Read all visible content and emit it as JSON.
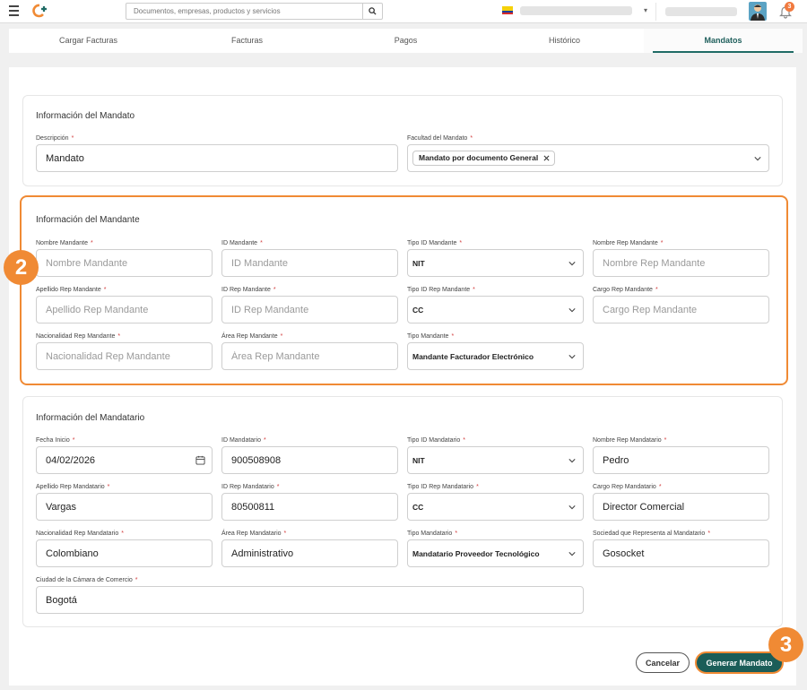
{
  "topbar": {
    "search_placeholder": "Documentos, empresas, productos y servicios",
    "notifications_count": "3",
    "accent": "#f08a34"
  },
  "tabs": [
    {
      "label": "Cargar Facturas"
    },
    {
      "label": "Facturas"
    },
    {
      "label": "Pagos"
    },
    {
      "label": "Histórico"
    },
    {
      "label": "Mandatos",
      "active": true
    }
  ],
  "mandato": {
    "title": "Información del Mandato",
    "descripcion_label": "Descripción",
    "descripcion_value": "Mandato",
    "facultad_label": "Facultad del Mandato",
    "facultad_chip": "Mandato por documento General"
  },
  "mandante": {
    "title": "Información del Mandante",
    "nombre_label": "Nombre Mandante",
    "nombre_placeholder": "Nombre Mandante",
    "id_label": "ID Mandante",
    "id_placeholder": "ID Mandante",
    "tipo_id_label": "Tipo ID Mandante",
    "tipo_id_value": "NIT",
    "nombre_rep_label": "Nombre Rep Mandante",
    "nombre_rep_placeholder": "Nombre Rep Mandante",
    "apellido_rep_label": "Apellido Rep Mandante",
    "apellido_rep_placeholder": "Apellido Rep Mandante",
    "id_rep_label": "ID Rep Mandante",
    "id_rep_placeholder": "ID Rep Mandante",
    "tipo_id_rep_label": "Tipo ID Rep Mandante",
    "tipo_id_rep_value": "CC",
    "cargo_rep_label": "Cargo Rep Mandante",
    "cargo_rep_placeholder": "Cargo Rep Mandante",
    "nacionalidad_label": "Nacionalidad Rep Mandante",
    "nacionalidad_placeholder": "Nacionalidad Rep Mandante",
    "area_label": "Área Rep Mandante",
    "area_placeholder": "Área Rep Mandante",
    "tipo_label": "Tipo Mandante",
    "tipo_value": "Mandante Facturador Electrónico"
  },
  "mandatario": {
    "title": "Información del Mandatario",
    "fecha_label": "Fecha Inicio",
    "fecha_value": "04/02/2026",
    "id_label": "ID Mandatario",
    "id_value": "900508908",
    "tipo_id_label": "Tipo ID Mandatario",
    "tipo_id_value": "NIT",
    "nombre_rep_label": "Nombre Rep Mandatario",
    "nombre_rep_value": "Pedro",
    "apellido_rep_label": "Apellido Rep Mandatario",
    "apellido_rep_value": "Vargas",
    "id_rep_label": "ID Rep Mandatario",
    "id_rep_value": "80500811",
    "tipo_id_rep_label": "Tipo ID Rep Mandatario",
    "tipo_id_rep_value": "CC",
    "cargo_rep_label": "Cargo Rep Mandatario",
    "cargo_rep_value": "Director Comercial",
    "nacionalidad_label": "Nacionalidad Rep Mandatario",
    "nacionalidad_value": "Colombiano",
    "area_label": "Área Rep Mandatario",
    "area_value": "Administrativo",
    "tipo_label": "Tipo Mandatario",
    "tipo_value": "Mandatario Proveedor Tecnológico",
    "sociedad_label": "Sociedad que Representa al Mandatario",
    "sociedad_value": "Gosocket",
    "ciudad_label": "Ciudad de la Cámara de Comercio",
    "ciudad_value": "Bogotá"
  },
  "actions": {
    "cancel_label": "Cancelar",
    "generate_label": "Generar Mandato"
  },
  "steps": {
    "step_mandante": "2",
    "step_generate": "3"
  },
  "required_mark": "*"
}
